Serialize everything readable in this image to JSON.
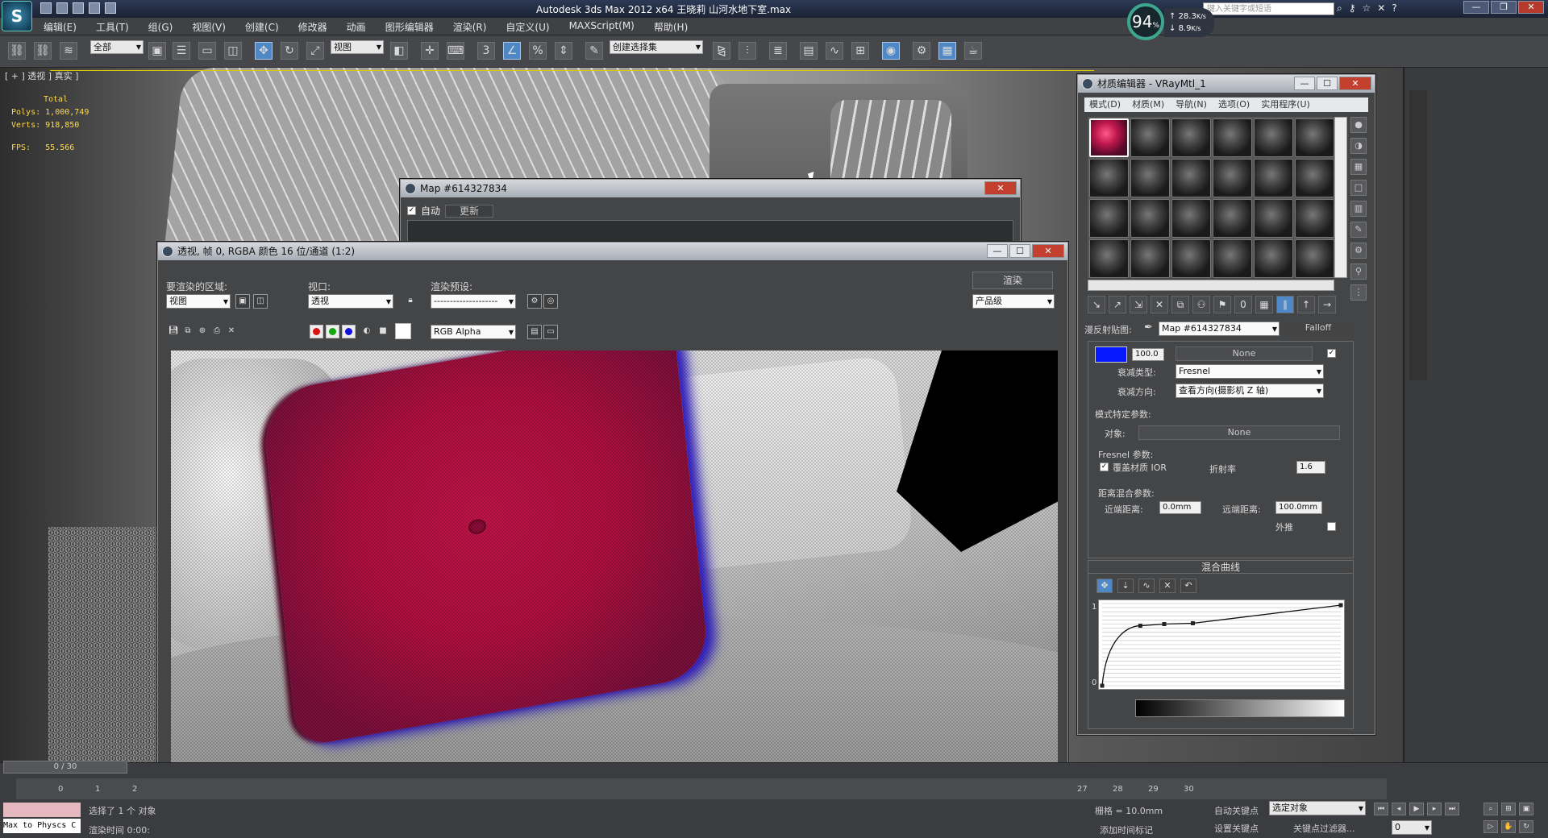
{
  "app": {
    "title": "Autodesk 3ds Max  2012 x64    王晓莉 山河水地下室.max",
    "search_placeholder": "键入关键字或短语",
    "logo": "3ds"
  },
  "net_widget": {
    "percent": "94",
    "percent_unit": "%",
    "up": "28.3",
    "up_unit": "K/s",
    "down": "8.9",
    "down_unit": "K/s"
  },
  "menu": [
    "编辑(E)",
    "工具(T)",
    "组(G)",
    "视图(V)",
    "创建(C)",
    "修改器",
    "动画",
    "图形编辑器",
    "渲染(R)",
    "自定义(U)",
    "MAXScript(M)",
    "帮助(H)"
  ],
  "toolbar": {
    "selection_filter": "全部",
    "ref_coord": "视图",
    "named_selection": "创建选择集",
    "snap_num": "3",
    "snap_percent": "%"
  },
  "viewport": {
    "label": "[ + ] 透视 ] 真实 ]",
    "stats_total": "Total",
    "polys_label": "Polys:",
    "polys_value": "1,000,749",
    "verts_label": "Verts:",
    "verts_value": "918,850",
    "fps_label": "FPS:",
    "fps_value": "55.566"
  },
  "map_window": {
    "title": "Map #614327834",
    "auto_label": "自动",
    "auto_checked": true,
    "update_label": "更新"
  },
  "render_window": {
    "title": "透视, 帧 0, RGBA 颜色 16 位/通道 (1:2)",
    "area_label": "要渲染的区域:",
    "area_value": "视图",
    "viewport_label": "视口:",
    "viewport_value": "透视",
    "preset_label": "渲染预设:",
    "preset_value": "--------------------",
    "render_button": "渲染",
    "quality_value": "产品级",
    "channel_value": "RGB Alpha"
  },
  "material_editor": {
    "title": "材质编辑器 - VRayMtl_1",
    "menu": [
      "模式(D)",
      "材质(M)",
      "导航(N)",
      "选项(O)",
      "实用程序(U)"
    ],
    "slot_label": "漫反射贴图:",
    "map_name": "Map #614327834",
    "map_type": "Falloff",
    "front_amount": "100.0",
    "front_color": "#0818ff",
    "none_label": "None",
    "falloff_type_label": "衰减类型:",
    "falloff_type_value": "Fresnel",
    "falloff_dir_label": "衰减方向:",
    "falloff_dir_value": "查看方向(摄影机 Z 轴)",
    "mode_params_label": "模式特定参数:",
    "object_label": "对象:",
    "object_value": "None",
    "fresnel_params_label": "Fresnel 参数:",
    "override_ior_label": "覆盖材质 IOR",
    "override_ior_checked": true,
    "ior_label": "折射率",
    "ior_value": "1.6",
    "distance_blend_label": "距离混合参数:",
    "near_label": "近端距离:",
    "near_value": "0.0mm",
    "far_label": "远端距离:",
    "far_value": "100.0mm",
    "extrapolate_label": "外推",
    "curve_section_label": "混合曲线",
    "curve_y_top": "1",
    "curve_y_bottom": "0"
  },
  "curve_data": {
    "points": [
      [
        0.0,
        0.0
      ],
      [
        0.16,
        0.73
      ],
      [
        0.26,
        0.75
      ],
      [
        0.38,
        0.76
      ],
      [
        1.0,
        0.98
      ]
    ]
  },
  "timeline": {
    "slider_label": "0 / 30",
    "ticks_left": [
      "0",
      "1",
      "2"
    ],
    "ticks_right": [
      "27",
      "28",
      "29",
      "30"
    ]
  },
  "status": {
    "selected_text": "选择了 1 个 对象",
    "render_time": "渲染时间 0:00:",
    "script_text": "Max to Physcs C",
    "grid_label": "栅格 = 10.0mm",
    "autokey_label": "自动关键点",
    "autokey_value": "选定对象",
    "setkey_label": "设置关键点",
    "keyfilter_label": "关键点过滤器...",
    "addtime_label": "添加时间标记",
    "frame_value": "0"
  }
}
